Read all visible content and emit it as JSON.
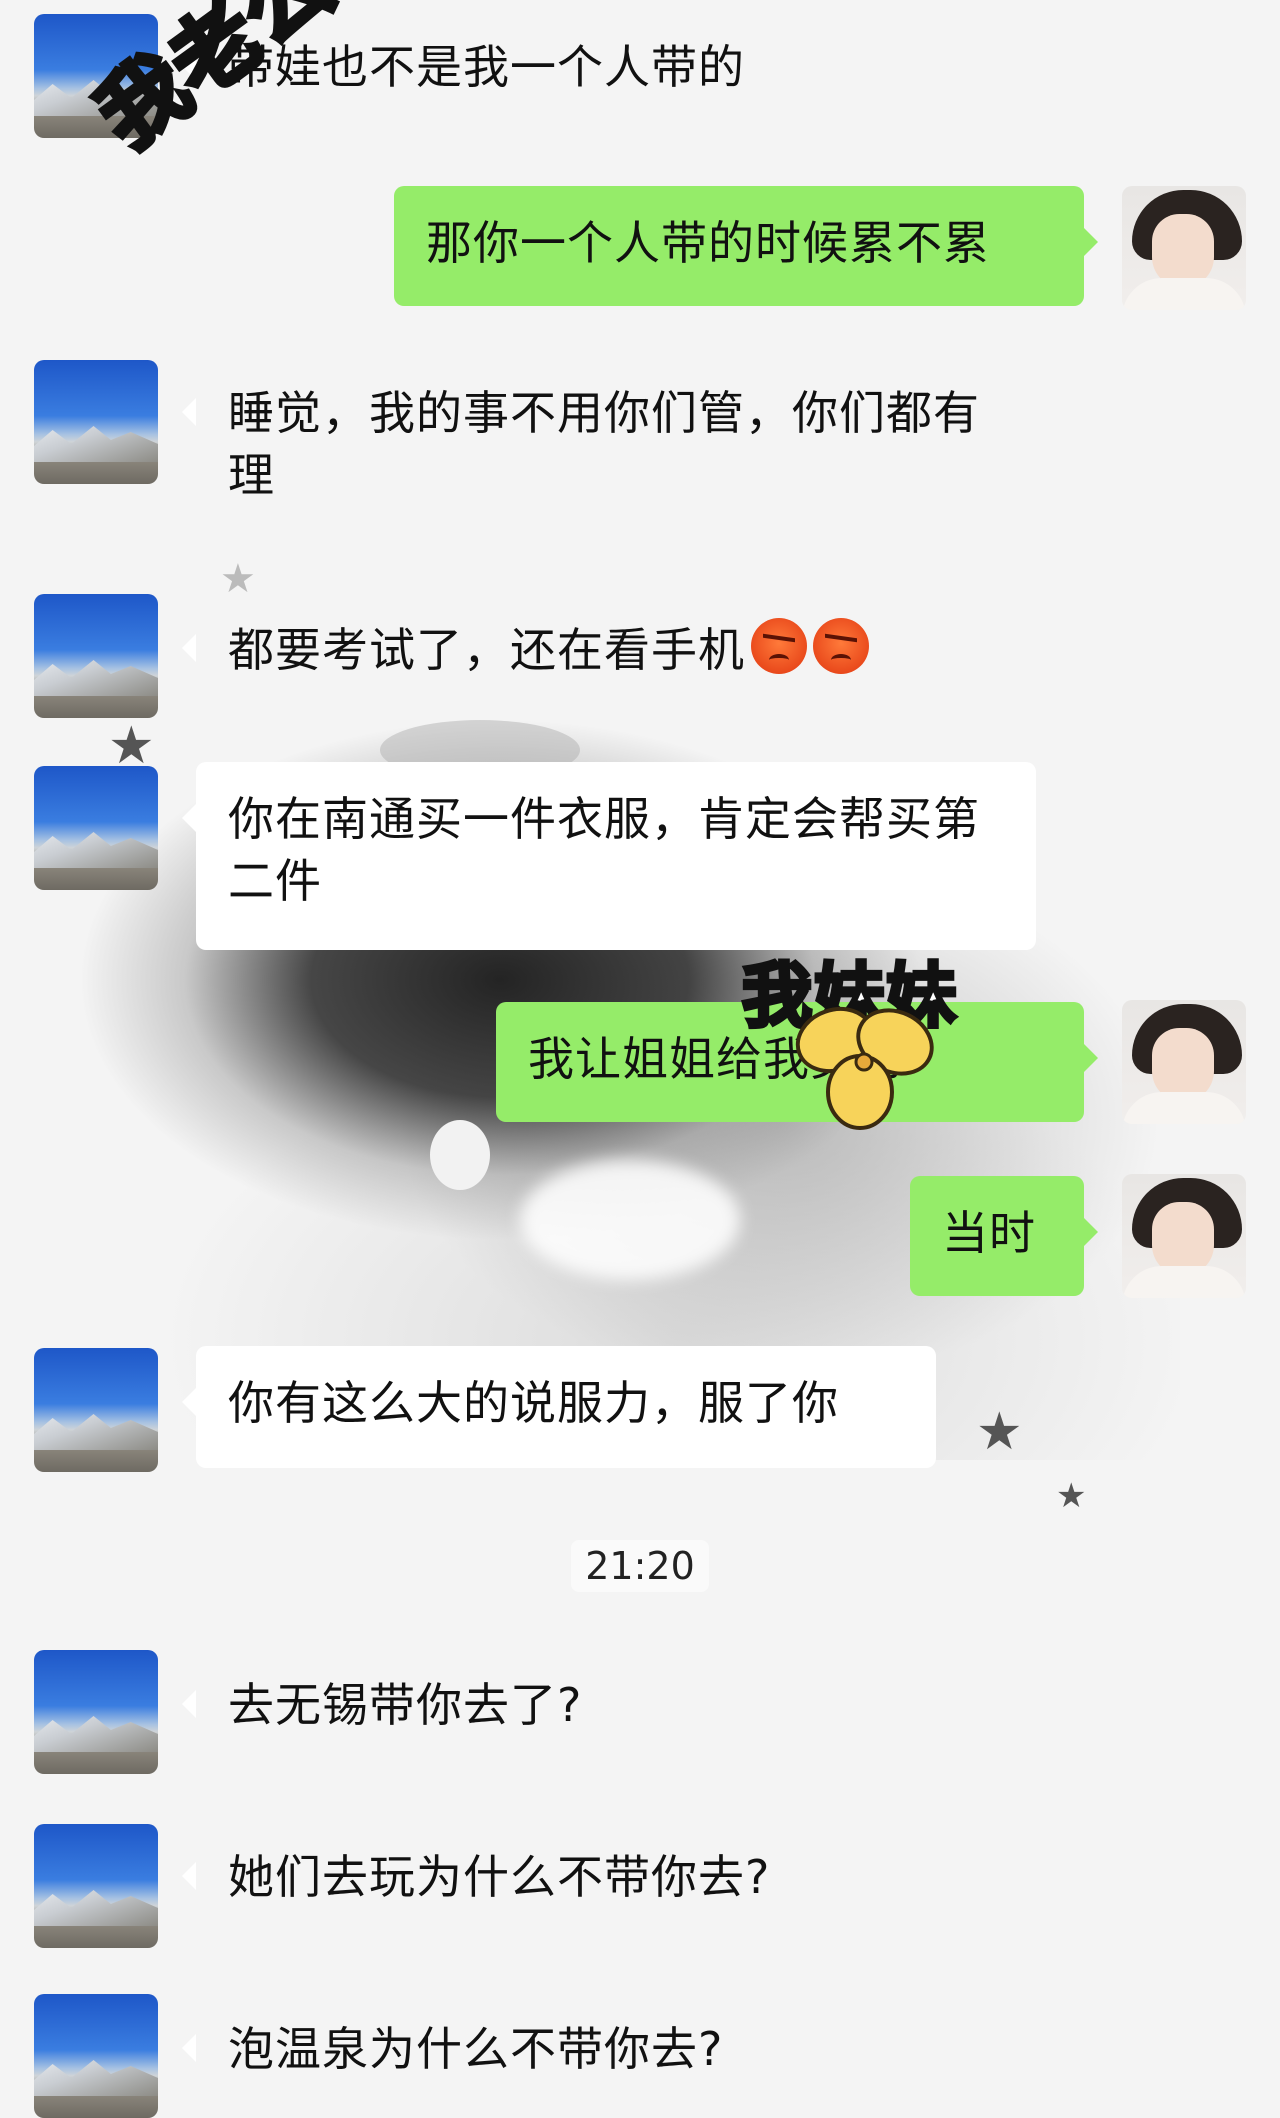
{
  "chat": {
    "messages": [
      {
        "side": "left",
        "text": "带娃也不是我一个人带的"
      },
      {
        "side": "right",
        "text": "那你一个人带的时候累不累"
      },
      {
        "side": "left",
        "text": "睡觉，我的事不用你们管，你们都有理"
      },
      {
        "side": "left",
        "text": "都要考试了，还在看手机",
        "emoji": [
          "angry-face-icon",
          "angry-face-icon"
        ]
      },
      {
        "side": "left",
        "text": "你在南通买一件衣服，肯定会帮买第二件"
      },
      {
        "side": "right",
        "text": "我让姐姐给我买的"
      },
      {
        "side": "right",
        "text": "当时"
      },
      {
        "side": "left",
        "text": "你有这么大的说服力，服了你"
      },
      {
        "side": "left",
        "text": "去无锡带你去了?"
      },
      {
        "side": "left",
        "text": "她们去玩为什么不带你去?"
      },
      {
        "side": "left",
        "text": "泡温泉为什么不带你去?"
      }
    ],
    "timestamp": "21:20"
  },
  "overlays": {
    "husband_label": "我老公",
    "sister_label": "我妹妹"
  },
  "colors": {
    "sent_bubble": "#95ec69",
    "received_bubble": "#ffffff",
    "background": "#f4f4f4"
  }
}
